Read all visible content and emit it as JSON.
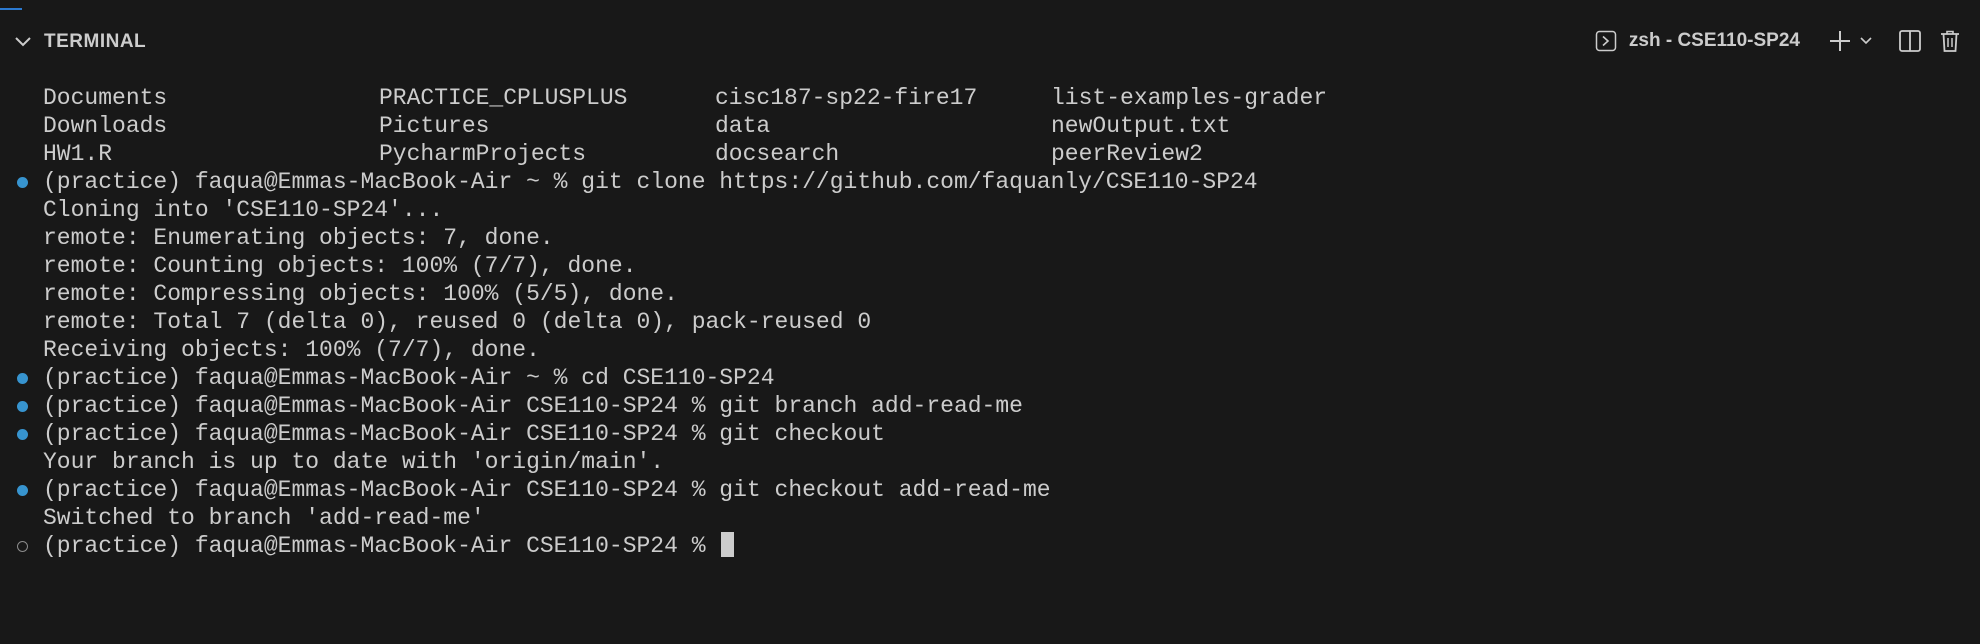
{
  "panel": {
    "title": "TERMINAL",
    "terminal_name": "zsh - CSE110-SP24",
    "icons": {
      "collapse": "chevron-down-icon",
      "terminal": "terminal-icon",
      "add": "plus-icon",
      "dropdown": "chevron-down-icon",
      "split": "split-terminal-icon",
      "kill": "trash-icon"
    }
  },
  "listing": {
    "rows": [
      [
        "Documents",
        "PRACTICE_CPLUSPLUS",
        "cisc187-sp22-fire17",
        "list-examples-grader"
      ],
      [
        "Downloads",
        "Pictures",
        "data",
        "newOutput.txt"
      ],
      [
        "HW1.R",
        "PycharmProjects",
        "docsearch",
        "peerReview2"
      ]
    ]
  },
  "output": [
    {
      "marker": "filled",
      "text": "(practice) faqua@Emmas-MacBook-Air ~ % git clone https://github.com/faquanly/CSE110-SP24"
    },
    {
      "marker": "none",
      "text": "Cloning into 'CSE110-SP24'..."
    },
    {
      "marker": "none",
      "text": "remote: Enumerating objects: 7, done."
    },
    {
      "marker": "none",
      "text": "remote: Counting objects: 100% (7/7), done."
    },
    {
      "marker": "none",
      "text": "remote: Compressing objects: 100% (5/5), done."
    },
    {
      "marker": "none",
      "text": "remote: Total 7 (delta 0), reused 0 (delta 0), pack-reused 0"
    },
    {
      "marker": "none",
      "text": "Receiving objects: 100% (7/7), done."
    },
    {
      "marker": "filled",
      "text": "(practice) faqua@Emmas-MacBook-Air ~ % cd CSE110-SP24"
    },
    {
      "marker": "filled",
      "text": "(practice) faqua@Emmas-MacBook-Air CSE110-SP24 % git branch add-read-me"
    },
    {
      "marker": "filled",
      "text": "(practice) faqua@Emmas-MacBook-Air CSE110-SP24 % git checkout"
    },
    {
      "marker": "none",
      "text": "Your branch is up to date with 'origin/main'."
    },
    {
      "marker": "filled",
      "text": "(practice) faqua@Emmas-MacBook-Air CSE110-SP24 % git checkout add-read-me"
    },
    {
      "marker": "none",
      "text": "Switched to branch 'add-read-me'"
    },
    {
      "marker": "empty",
      "text": "(practice) faqua@Emmas-MacBook-Air CSE110-SP24 % "
    }
  ],
  "colors": {
    "background": "#181818",
    "text": "#cccccc",
    "decoration_success": "#3794cf",
    "decoration_pending": "#8b8b8b"
  }
}
